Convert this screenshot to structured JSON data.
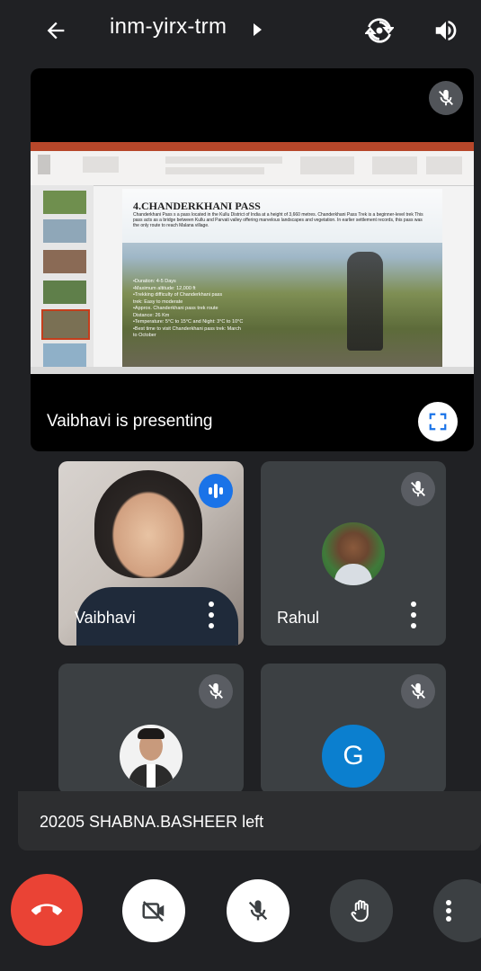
{
  "header": {
    "meeting_code": "inm-yirx-trm",
    "back_icon": "arrow-left-icon",
    "switch_camera_icon": "switch-camera-icon",
    "audio_icon": "speaker-icon"
  },
  "presentation": {
    "presenter_label": "Vaibhavi is presenting",
    "slide": {
      "title": "4.CHANDERKHANI PASS",
      "paragraph": "Chanderkhani Pass s a pass located in the Kullu District of India at a height of 3,660 metres. Chanderkhani Pass Trek is a beginner-level trek This pass acts as a bridge between Kullu and Parvati valley offering marvelous landscapes and vegetation. In earlier settlement records, this pass was the only route to reach Malana village.",
      "bullets": [
        "•Duration: 4-5 Days",
        "•Maximum altitude: 12,000 ft",
        "•Trekking difficulty of Chanderkhani pass",
        "trek: Easy to moderate",
        "•Approx. Chanderkhani pass trek route",
        "Distance: 26 Km",
        "•Temperature: 5°C to 15°C and Night: 3°C to 10°C",
        "•Best time to visit Chanderkhani pass trek: March",
        "to October"
      ]
    }
  },
  "participants": [
    {
      "name": "Vaibhavi",
      "speaking": true
    },
    {
      "name": "Rahul",
      "muted": true
    },
    {
      "name": "",
      "muted": true
    },
    {
      "name": "",
      "muted": true,
      "initial": "G"
    }
  ],
  "notification": "20205 SHABNA.BASHEER left",
  "controls": {
    "end_call_color": "#ea4335",
    "tile_bg": "#3c4043",
    "accent_blue": "#1a73e8"
  }
}
